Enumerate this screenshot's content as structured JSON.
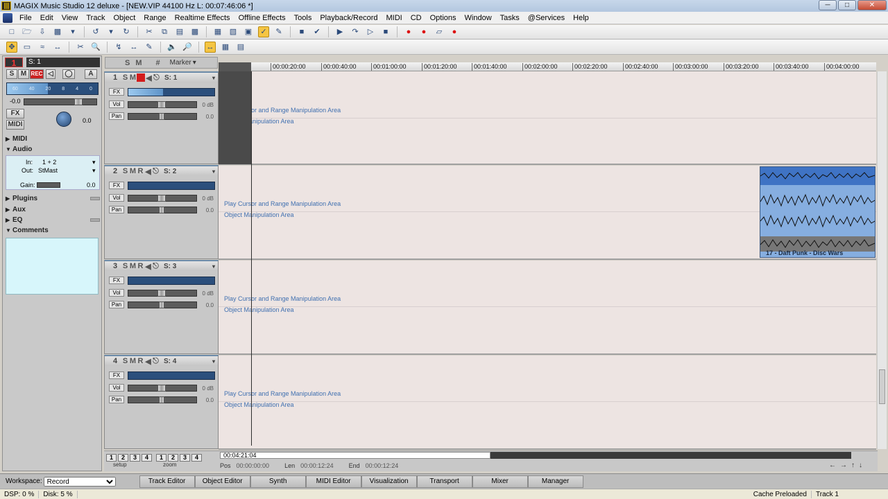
{
  "window": {
    "title": "MAGIX Music Studio 12 deluxe - [NEW.VIP   44100 Hz L: 00:07:46:06 *]"
  },
  "menu": [
    "File",
    "Edit",
    "View",
    "Track",
    "Object",
    "Range",
    "Realtime Effects",
    "Offline Effects",
    "Tools",
    "Playback/Record",
    "MIDI",
    "CD",
    "Options",
    "Window",
    "Tasks",
    "@Services",
    "Help"
  ],
  "left_panel": {
    "track_number": "1",
    "track_select": "S: 1",
    "buttons": {
      "solo": "S",
      "mute": "M",
      "rec": "REC",
      "auto": "A"
    },
    "meter_ticks": [
      "60",
      "40",
      "20",
      "8",
      "4",
      "0"
    ],
    "db_value": "-0.0",
    "knob_value": "0.0",
    "fx_label": "FX",
    "midi_label": "MIDI",
    "sections": {
      "midi": "MIDI",
      "audio": "Audio",
      "plugins": "Plugins",
      "aux": "Aux",
      "eq": "EQ",
      "comments": "Comments"
    },
    "audio": {
      "in_label": "In:",
      "in_value": "1 + 2",
      "out_label": "Out:",
      "out_value": "StMast",
      "gain_label": "Gain:",
      "gain_value": "0.0"
    }
  },
  "track_header_top": {
    "solo": "S",
    "mute": "M",
    "grid": "#",
    "marker": "Marker"
  },
  "ruler_ticks": [
    "00:00:20:00",
    "00:00:40:00",
    "00:01:00:00",
    "00:01:20:00",
    "00:01:40:00",
    "00:02:00:00",
    "00:02:20:00",
    "00:02:40:00",
    "00:03:00:00",
    "00:03:20:00",
    "00:03:40:00",
    "00:04:00:00"
  ],
  "tracks": [
    {
      "num": "1",
      "solo": "S",
      "mute": "M",
      "rec": "",
      "sname": "S: 1",
      "fx": "FX",
      "vol": "Vol",
      "pan": "Pan",
      "vol_db": "0 dB",
      "pan_val": "0.0",
      "area1": "Play Cursor and Range Manipulation Area",
      "area2": "Object Manipulation Area"
    },
    {
      "num": "2",
      "solo": "S",
      "mute": "M",
      "rec": "R",
      "sname": "S: 2",
      "fx": "FX",
      "vol": "Vol",
      "pan": "Pan",
      "vol_db": "0 dB",
      "pan_val": "0.0",
      "area1": "Play Cursor and Range Manipulation Area",
      "area2": "Object Manipulation Area"
    },
    {
      "num": "3",
      "solo": "S",
      "mute": "M",
      "rec": "R",
      "sname": "S: 3",
      "fx": "FX",
      "vol": "Vol",
      "pan": "Pan",
      "vol_db": "0 dB",
      "pan_val": "0.0",
      "area1": "Play Cursor and Range Manipulation Area",
      "area2": "Object Manipulation Area"
    },
    {
      "num": "4",
      "solo": "S",
      "mute": "M",
      "rec": "R",
      "sname": "S: 4",
      "fx": "FX",
      "vol": "Vol",
      "pan": "Pan",
      "vol_db": "0 dB",
      "pan_val": "0.0",
      "area1": "Play Cursor and Range Manipulation Area",
      "area2": "Object Manipulation Area"
    }
  ],
  "clip": {
    "label": "17 - Daft Punk - Disc Wars"
  },
  "zoom_buttons": [
    "1",
    "2",
    "3",
    "4",
    "1",
    "2",
    "3",
    "4"
  ],
  "zoom_labels": {
    "setup": "setup",
    "zoom": "zoom"
  },
  "position": {
    "current": "00:04:21:04",
    "pos_label": "Pos",
    "pos_value": "00:00:00:00",
    "len_label": "Len",
    "len_value": "00:00:12:24",
    "end_label": "End",
    "end_value": "00:00:12:24"
  },
  "workspace": {
    "label": "Workspace:",
    "value": "Record",
    "tabs": [
      "Track Editor",
      "Object Editor",
      "Synth",
      "MIDI Editor",
      "Visualization",
      "Transport",
      "Mixer",
      "Manager"
    ]
  },
  "status": {
    "dsp": "DSP: 0 %",
    "disk": "Disk: 5 %",
    "cache": "Cache Preloaded",
    "track": "Track 1"
  }
}
